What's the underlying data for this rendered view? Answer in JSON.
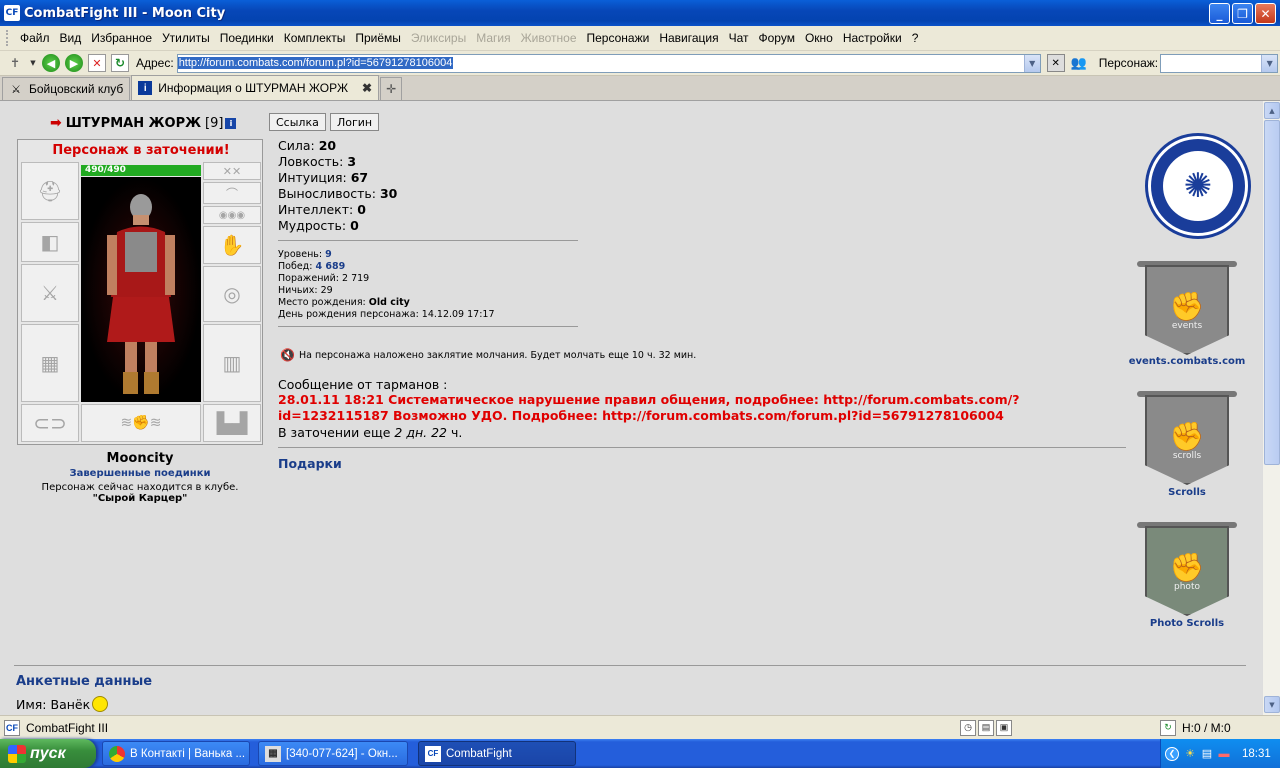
{
  "window": {
    "title": "CombatFight III - Moon City",
    "app_icon": "CF"
  },
  "menu": [
    "Файл",
    "Вид",
    "Избранное",
    "Утилиты",
    "Поединки",
    "Комплекты",
    "Приёмы",
    "Эликсиры",
    "Магия",
    "Животное",
    "Персонажи",
    "Навигация",
    "Чат",
    "Форум",
    "Окно",
    "Настройки",
    "?"
  ],
  "menu_disabled": [
    "Эликсиры",
    "Магия",
    "Животное"
  ],
  "toolbar": {
    "address_label": "Адрес:",
    "address_value": "http://forum.combats.com/forum.pl?id=56791278106004",
    "person_label": "Персонаж:",
    "person_value": ""
  },
  "tabs": [
    {
      "label": "Бойцовский клуб",
      "active": false
    },
    {
      "label": "Информация о ШТУРМАН ЖОРЖ",
      "active": true
    }
  ],
  "character": {
    "name": "ШТУРМАН ЖОРЖ",
    "level_badge": "[9]",
    "jail_status": "Персонаж в заточении!",
    "hp": "490/490",
    "city": "Mooncity",
    "finished_fights": "Завершенные поединки",
    "location_text": "Персонаж сейчас находится в клубе.",
    "club": "\"Сырой Карцер\""
  },
  "buttons": {
    "link": "Ссылка",
    "login": "Логин"
  },
  "stats": [
    {
      "label": "Сила:",
      "value": "20"
    },
    {
      "label": "Ловкость:",
      "value": "3"
    },
    {
      "label": "Интуиция:",
      "value": "67"
    },
    {
      "label": "Выносливость:",
      "value": "30"
    },
    {
      "label": "Интеллект:",
      "value": "0"
    },
    {
      "label": "Мудрость:",
      "value": "0"
    }
  ],
  "info": {
    "level_label": "Уровень:",
    "level": "9",
    "wins_label": "Побед:",
    "wins": "4 689",
    "losses_label": "Поражений:",
    "losses": "2 719",
    "draws_label": "Ничьих:",
    "draws": "29",
    "birthplace_label": "Место рождения:",
    "birthplace": "Old city",
    "birthday_label": "День рождения персонажа:",
    "birthday": "14.12.09 17:17"
  },
  "silence": "На персонажа наложено заклятие молчания. Будет молчать еще 10 ч. 32 мин.",
  "message": {
    "from": "Сообщение от тарманов :",
    "text": "28.01.11 18:21 Систематическое нарушение правил общения, подробнее: http://forum.combats.com/?id=1232115187 Возможно УДО. Подробнее: http://forum.combats.com/forum.pl?id=56791278106004",
    "jail_prefix": "В заточении еще",
    "jail_time": "2 дн. 22",
    "jail_suffix": "ч."
  },
  "gifts": "Подарки",
  "profile": {
    "title": "Анкетные данные",
    "name_label": "Имя:",
    "name_value": "Ванёк"
  },
  "sidebar": {
    "events_caption": "events.combats.com",
    "events_label": "events",
    "scrolls_caption": "Scrolls",
    "scrolls_label": "scrolls",
    "photo_caption": "Photo Scrolls",
    "photo_label": "photo"
  },
  "statusbar": {
    "title": "CombatFight III",
    "hm": "Н:0 / М:0"
  },
  "taskbar": {
    "start": "пуск",
    "tasks": [
      "В Контакті | Ванька ...",
      "[340-077-624] - Окн...",
      "CombatFight"
    ],
    "clock": "18:31"
  }
}
